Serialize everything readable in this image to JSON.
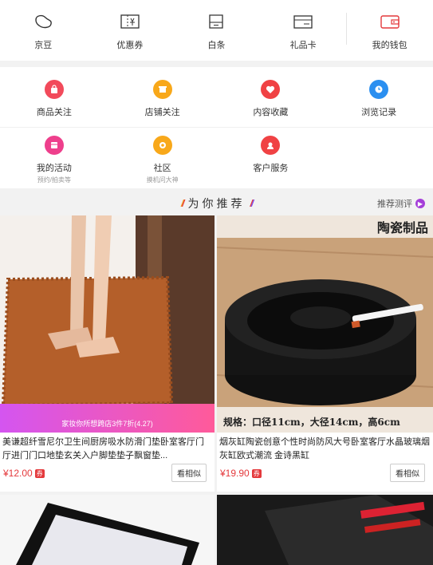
{
  "wallet": {
    "items": [
      {
        "label": "京豆",
        "icon": "bean-icon"
      },
      {
        "label": "优惠券",
        "icon": "coupon-icon"
      },
      {
        "label": "白条",
        "icon": "baitiao-icon"
      },
      {
        "label": "礼品卡",
        "icon": "gift-card-icon"
      },
      {
        "label": "我的钱包",
        "icon": "wallet-icon"
      }
    ]
  },
  "services": {
    "row1": [
      {
        "label": "商品关注",
        "icon": "bag-icon",
        "color": "#f24a5b"
      },
      {
        "label": "店铺关注",
        "icon": "store-icon",
        "color": "#f8a81a"
      },
      {
        "label": "内容收藏",
        "icon": "heart-icon",
        "color": "#f04244"
      },
      {
        "label": "浏览记录",
        "icon": "clock-icon",
        "color": "#2b8ff0"
      }
    ],
    "row2": [
      {
        "label": "我的活动",
        "sub": "预约/拍卖等",
        "icon": "activity-icon",
        "color": "#ee3f8c"
      },
      {
        "label": "社区",
        "sub": "摸机问大神",
        "icon": "community-icon",
        "color": "#f8a81a"
      },
      {
        "label": "客户服务",
        "icon": "customer-service-icon",
        "color": "#f04244"
      }
    ]
  },
  "recommend": {
    "title": "为你推荐",
    "link": "推荐测评"
  },
  "products": [
    {
      "title": "美谦超纤雪尼尔卫生间厨房吸水防滑门垫卧室客厅门厅进门门口地垫玄关入户脚垫垫子飘窗垫...",
      "price": "¥12.00",
      "quan": "券",
      "similar": "看相似",
      "promo": "家妆你所想跨店3件7折(4.27)"
    },
    {
      "title": "烟灰缸陶瓷创意个性时尚防风大号卧室客厅水晶玻璃烟灰缸欧式潮流 金诗黑缸",
      "price": "¥19.90",
      "quan": "券",
      "similar": "看相似",
      "badge": "陶瓷制品",
      "spec": "规格：口径11cm，大径14cm，高6cm"
    }
  ]
}
